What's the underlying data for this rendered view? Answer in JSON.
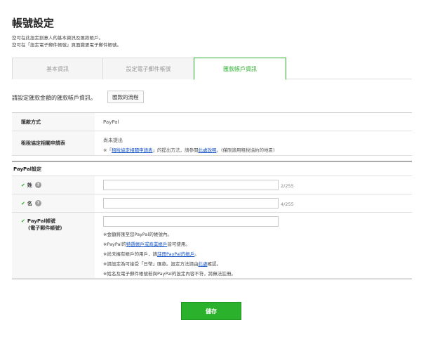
{
  "page": {
    "title": "帳號設定",
    "desc1": "您可在此設定創意人的基本資訊及匯款帳戶。",
    "desc2": "您可在「設定電子郵件帳號」頁面變更電子郵件帳號。"
  },
  "tabs": [
    {
      "label": "基本資訊",
      "active": false
    },
    {
      "label": "設定電子郵件帳號",
      "active": false
    },
    {
      "label": "匯款帳戶資訊",
      "active": true
    }
  ],
  "intro": {
    "text": "請設定匯款金額的匯款帳戶資訊。",
    "flow_button": "匯款的流程"
  },
  "info_table": {
    "method_label": "匯款方式",
    "method_value": "PayPal",
    "tax_label": "租稅協定相關申請表",
    "tax_status": "尚未提出",
    "tax_note_prefix": "※「",
    "tax_note_link1": "租稅協定相關申請表",
    "tax_note_mid": "」的提出方法，請參閱",
    "tax_note_link2": "此處說明",
    "tax_note_suffix": "。(僅限適用租稅協約的地區)"
  },
  "paypal": {
    "section_title": "PayPal設定",
    "last_name_label": "姓",
    "last_name_value": "",
    "last_name_count": "2/255",
    "first_name_label": "名",
    "first_name_value": "",
    "first_name_count": "4/255",
    "account_label1": "PayPal帳號",
    "account_label2": "(電子郵件帳號)",
    "account_value": "",
    "note1": "※金額將匯至您PayPal的帳號內。",
    "note2_prefix": "※PayPal的",
    "note2_link": "特選帳戶或商業帳戶",
    "note2_suffix": "皆可使用。",
    "note3_prefix": "※尚未擁有帳戶的用戶，請",
    "note3_link": "註冊PayPal的帳戶",
    "note3_suffix": "。",
    "note4_prefix": "※請設定為可接受「日幣」匯款。設定方法請由",
    "note4_link": "此處",
    "note4_suffix": "確認。",
    "note5": "※姓名及電子郵件帳號若與PayPal的設定內容不符，將無法註冊。"
  },
  "actions": {
    "save": "儲存"
  },
  "colors": {
    "accent": "#2bb12b",
    "link": "#1a57c8"
  }
}
